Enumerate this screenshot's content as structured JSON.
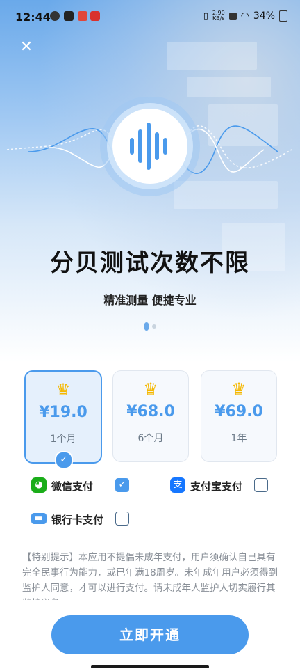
{
  "status_bar": {
    "time": "12:44",
    "net_speed_value": "2.90",
    "net_speed_unit": "KB/s",
    "battery": "34%"
  },
  "hero": {
    "title": "分贝测试次数不限",
    "subtitle": "精准测量 便捷专业",
    "page_indicator": {
      "current": 1,
      "total": 2
    }
  },
  "plans": [
    {
      "price": "¥19.0",
      "term": "1个月",
      "selected": true
    },
    {
      "price": "¥68.0",
      "term": "6个月",
      "selected": false
    },
    {
      "price": "¥69.0",
      "term": "1年",
      "selected": false
    }
  ],
  "payment": {
    "wechat": {
      "label": "微信支付",
      "checked": true
    },
    "alipay": {
      "label": "支付宝支付",
      "checked": false
    },
    "bank": {
      "label": "银行卡支付",
      "checked": false
    }
  },
  "notice": "【特别提示】本应用不提倡未成年支付，用户须确认自己具有完全民事行为能力，或已年满18周岁。未年成年用户必须得到监护人同意，才可以进行支付。请未成年人监护人切实履行其监护义务。",
  "cta_label": "立即开通",
  "colors": {
    "accent": "#4a9aec",
    "wechat": "#1aad19",
    "alipay": "#1677ff",
    "crown": "#f5b800"
  }
}
